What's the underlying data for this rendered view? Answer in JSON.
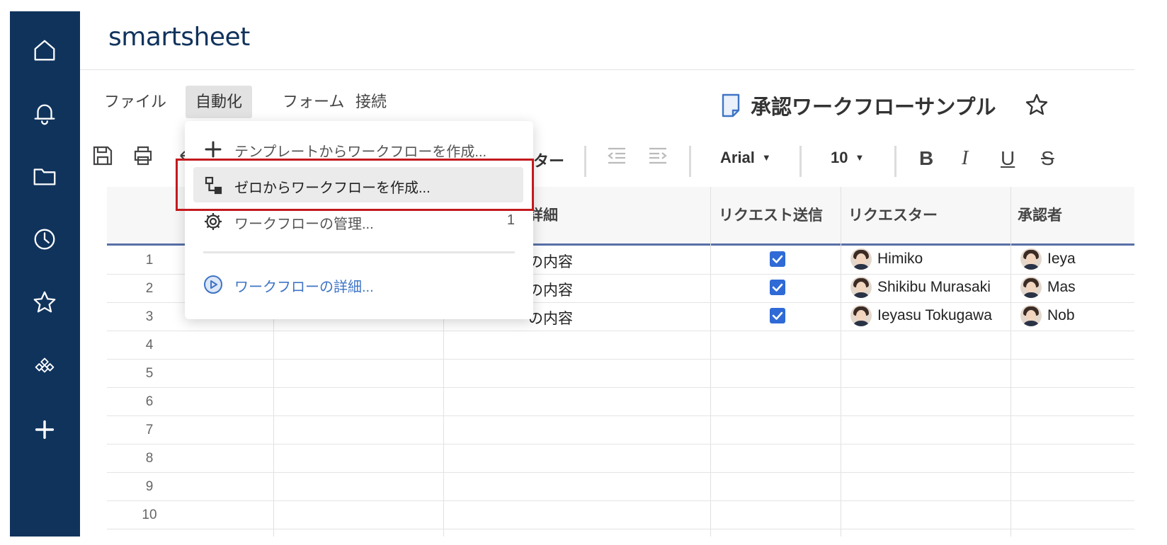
{
  "app": {
    "logo": "smartsheet"
  },
  "rail": {
    "icons": [
      "home-icon",
      "bell-icon",
      "folder-icon",
      "clock-icon",
      "star-icon",
      "apps-icon",
      "plus-icon"
    ]
  },
  "menu": {
    "items": [
      "ファイル",
      "自動化",
      "フォーム",
      "接続"
    ],
    "active_index": 1
  },
  "sheet": {
    "title": "承認ワークフローサンプル"
  },
  "toolbar": {
    "filter_label_partial": "ター",
    "font": "Arial",
    "font_size": "10",
    "bold": "B",
    "italic": "I",
    "underline": "U",
    "strike": "S"
  },
  "grid": {
    "columns": {
      "details_partial": "詳細",
      "request_sent": "リクエスト送信",
      "requester": "リクエスター",
      "approver": "承認者"
    },
    "row_numbers": [
      "1",
      "2",
      "3",
      "4",
      "5",
      "6",
      "7",
      "8",
      "9",
      "10"
    ],
    "rows": [
      {
        "details": "の内容",
        "sent": true,
        "requester": "Himiko",
        "approver": "Ieya"
      },
      {
        "details": "の内容",
        "sent": true,
        "requester": "Shikibu Murasaki",
        "approver": "Mas"
      },
      {
        "details": "の内容",
        "sent": true,
        "requester": "Ieyasu Tokugawa",
        "approver": "Nob"
      }
    ]
  },
  "dropdown": {
    "items": [
      {
        "label": "テンプレートからワークフローを作成...",
        "icon": "plus-icon"
      },
      {
        "label": "ゼロからワークフローを作成...",
        "icon": "workflow-icon",
        "highlighted": true
      },
      {
        "label": "ワークフローの管理...",
        "icon": "gear-icon",
        "count": "1"
      },
      {
        "label": "ワークフローの詳細...",
        "icon": "play-circle-icon"
      }
    ]
  },
  "colors": {
    "rail": "#10335c",
    "highlight_box": "#c4191d",
    "checkbox": "#2f6ad6",
    "link": "#3f74c5"
  }
}
